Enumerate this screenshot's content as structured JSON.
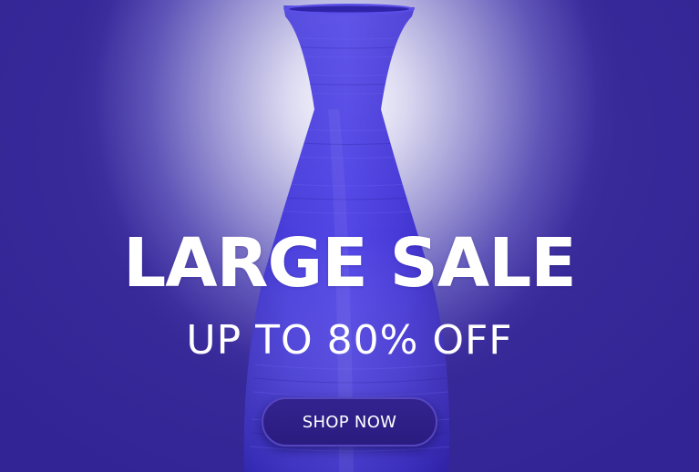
{
  "banner": {
    "headline": "LARGE SALE",
    "subline": "UP TO 80% OFF",
    "cta_label": "SHOP NOW"
  },
  "colors": {
    "background": "#382a99",
    "glow": "#ffffff",
    "vase": "#4a3ce0",
    "button": "#2e1f88",
    "text": "#ffffff"
  },
  "icons": {
    "hero_image": "blue-vase"
  }
}
